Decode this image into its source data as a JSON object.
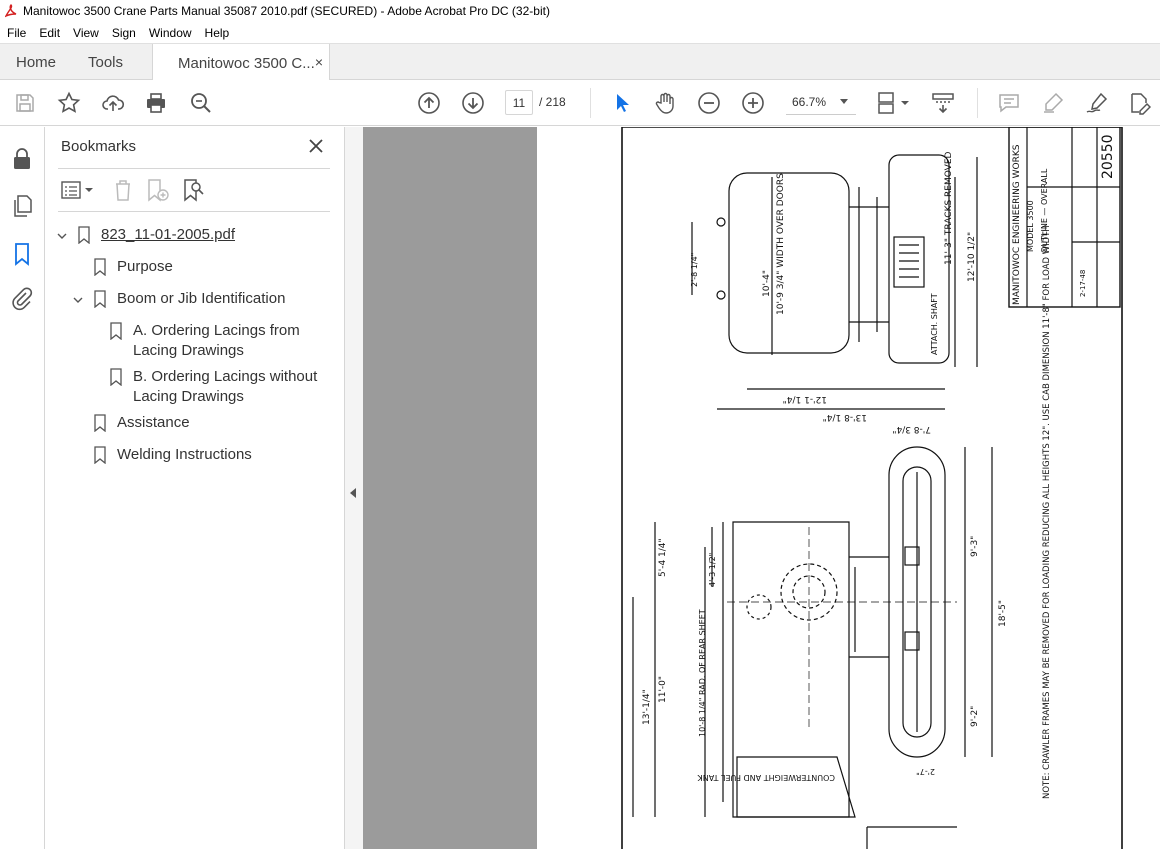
{
  "window": {
    "title": "Manitowoc 3500 Crane Parts Manual 35087 2010.pdf (SECURED) - Adobe Acrobat Pro DC (32-bit)"
  },
  "menu": [
    "File",
    "Edit",
    "View",
    "Sign",
    "Window",
    "Help"
  ],
  "tabs": {
    "home": "Home",
    "tools": "Tools",
    "document": "Manitowoc 3500 C...",
    "close": "×"
  },
  "toolbar": {
    "current_page": "11",
    "total_pages": "/ 218",
    "zoom": "66.7%"
  },
  "bookmarks": {
    "title": "Bookmarks",
    "items": [
      {
        "label": "823_11-01-2005.pdf"
      },
      {
        "label": "Purpose"
      },
      {
        "label": "Boom or Jib Identification"
      },
      {
        "label": "A. Ordering Lacings from",
        "label2": "Lacing Drawings"
      },
      {
        "label": "B. Ordering Lacings without",
        "label2": "Lacing Drawings"
      },
      {
        "label": "Assistance"
      },
      {
        "label": "Welding Instructions"
      }
    ]
  },
  "drawing": {
    "title_block": {
      "company": "MANITOWOC ENGINEERING WORKS",
      "model": "MODEL 3500",
      "sheet_title": "OUTLINE — OVERALL",
      "drawing_number": "20550",
      "date": "2-17-48"
    },
    "dimensions": [
      "10'-4\"",
      "10'-9 3/4\" WIDTH OVER DOORS",
      "12'-10 1/2\"",
      "11'-3\" TRACKS REMOVED",
      "ATTACH. SHAFT",
      "12'-1 1/4\"",
      "13'-8 1/4\"",
      "7'-8 3/4\"",
      "9'-3\"",
      "18'-5\"",
      "9'-2\"",
      "13'-1/4\"",
      "11'-0\"",
      "10'-8 1/4\" RAD. OF REAR SHEET",
      "COUNTERWEIGHT AND FUEL TANK",
      "5'-4 1/4\"",
      "4'-3 1/2\"",
      "2'-8 1/4\"",
      "2'-7\""
    ],
    "note": "NOTE: CRAWLER FRAMES MAY BE REMOVED FOR LOADING REDUCING ALL HEIGHTS 12\". USE CAB DIMENSION 11'-8\" FOR LOAD WIDTH"
  }
}
